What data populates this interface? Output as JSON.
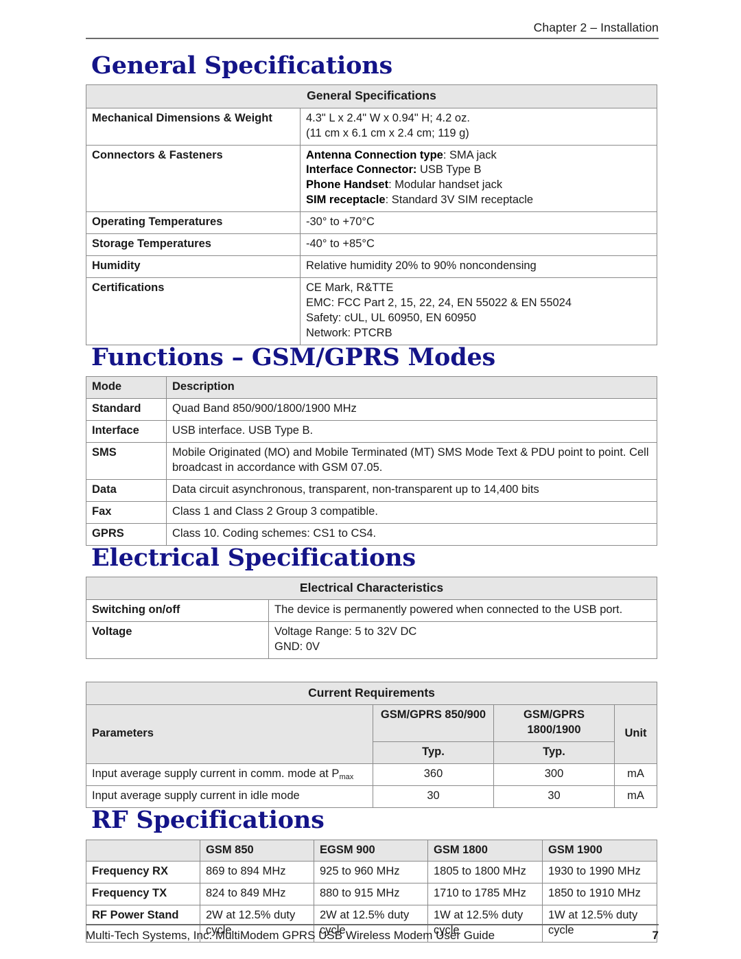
{
  "header": {
    "chapter": "Chapter 2 – Installation"
  },
  "footer": {
    "text": "Multi-Tech Systems, Inc. MultiModem GPRS USB Wireless Modem User Guide",
    "page_number": "7"
  },
  "sections": {
    "general": {
      "heading": "General Specifications",
      "table_title": "General Specifications",
      "rows": [
        {
          "label": "Mechanical Dimensions & Weight",
          "lines": [
            {
              "text": "4.3\" L x 2.4\" W x 0.94\" H; 4.2 oz."
            },
            {
              "text": "(11 cm x 6.1 cm x 2.4 cm; 119 g)"
            }
          ]
        },
        {
          "label": "Connectors & Fasteners",
          "lines": [
            {
              "bold": "Antenna Connection type",
              "text": ": SMA jack"
            },
            {
              "bold": "Interface Connector:",
              "text": " USB Type B"
            },
            {
              "bold": "Phone Handset",
              "text": ": Modular handset jack"
            },
            {
              "bold": "SIM receptacle",
              "text": ": Standard 3V SIM receptacle"
            }
          ]
        },
        {
          "label": "Operating Temperatures",
          "lines": [
            {
              "text": "-30° to +70°C"
            }
          ]
        },
        {
          "label": "Storage Temperatures",
          "lines": [
            {
              "text": "-40° to +85°C"
            }
          ]
        },
        {
          "label": "Humidity",
          "lines": [
            {
              "text": "Relative humidity 20% to 90% noncondensing"
            }
          ]
        },
        {
          "label": "Certifications",
          "lines": [
            {
              "text": "CE Mark, R&TTE"
            },
            {
              "text": "EMC: FCC Part 2, 15, 22, 24, EN 55022 & EN 55024"
            },
            {
              "text": "Safety: cUL, UL 60950, EN 60950"
            },
            {
              "text": "Network: PTCRB"
            }
          ]
        }
      ]
    },
    "functions": {
      "heading": "Functions – GSM/GPRS Modes",
      "columns": [
        "Mode",
        "Description"
      ],
      "rows": [
        {
          "mode": "Standard",
          "description": "Quad Band 850/900/1800/1900 MHz"
        },
        {
          "mode": "Interface",
          "description": "USB interface. USB Type B."
        },
        {
          "mode": "SMS",
          "description": "Mobile Originated (MO) and Mobile Terminated (MT) SMS Mode Text & PDU point to point. Cell broadcast in accordance with GSM 07.05."
        },
        {
          "mode": "Data",
          "description": "Data circuit asynchronous, transparent, non-transparent up to 14,400 bits"
        },
        {
          "mode": "Fax",
          "description": "Class 1 and Class 2 Group 3 compatible."
        },
        {
          "mode": "GPRS",
          "description": "Class 10.  Coding schemes: CS1 to CS4."
        }
      ]
    },
    "electrical": {
      "heading": "Electrical Specifications",
      "table_title": "Electrical Characteristics",
      "rows": [
        {
          "label": "Switching on/off",
          "lines": [
            "The device is permanently powered when connected to the USB port."
          ]
        },
        {
          "label": "Voltage",
          "lines": [
            "Voltage Range: 5 to 32V DC",
            "GND: 0V"
          ]
        }
      ]
    },
    "current": {
      "table_title": "Current Requirements",
      "header": {
        "parameters": "Parameters",
        "band_1": "GSM/GPRS 850/900",
        "band_2": "GSM/GPRS 1800/1900",
        "unit": "Unit",
        "typ_1": "Typ.",
        "typ_2": "Typ."
      },
      "rows": [
        {
          "parameter_pre": "Input average supply current in comm. mode at P",
          "parameter_sub": "max",
          "parameter_post": "",
          "value_1": "360",
          "value_2": "300",
          "unit": "mA"
        },
        {
          "parameter_pre": "Input average supply current in idle mode",
          "parameter_sub": "",
          "parameter_post": "",
          "value_1": "30",
          "value_2": "30",
          "unit": "mA"
        }
      ]
    },
    "rf": {
      "heading": "RF Specifications",
      "columns": [
        "",
        "GSM 850",
        "EGSM 900",
        "GSM 1800",
        "GSM 1900"
      ],
      "rows": [
        {
          "label": "Frequency RX",
          "values": [
            "869 to 894 MHz",
            "925 to 960 MHz",
            "1805 to 1800 MHz",
            "1930 to 1990 MHz"
          ]
        },
        {
          "label": "Frequency TX",
          "values": [
            "824 to 849 MHz",
            "880 to 915 MHz",
            "1710 to 1785 MHz",
            "1850 to 1910 MHz"
          ]
        },
        {
          "label": "RF Power Stand",
          "values": [
            "2W at 12.5% duty cycle",
            "2W at 12.5% duty cycle",
            "1W at 12.5% duty cycle",
            "1W at 12.5% duty cycle"
          ]
        }
      ]
    }
  },
  "colors": {
    "heading_navy": "#141488",
    "table_header_bg": "#e6e6e6",
    "border_gray": "#8a8a8a",
    "rule_gray": "#6b6b6b"
  }
}
